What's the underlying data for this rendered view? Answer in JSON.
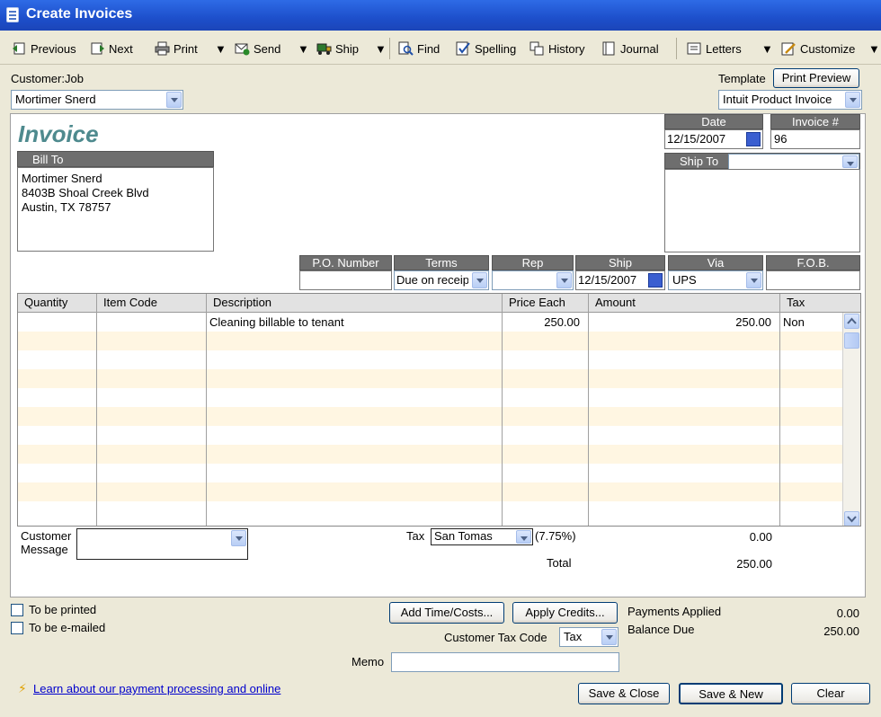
{
  "window": {
    "title": "Create Invoices"
  },
  "toolbar": {
    "previous": "Previous",
    "next": "Next",
    "print": "Print",
    "send": "Send",
    "ship": "Ship",
    "find": "Find",
    "spelling": "Spelling",
    "history": "History",
    "journal": "Journal",
    "letters": "Letters",
    "customize": "Customize"
  },
  "header": {
    "customer_job_label": "Customer:Job",
    "customer_value": "Mortimer Snerd",
    "template_label": "Template",
    "print_preview": "Print Preview",
    "template_value": "Intuit Product Invoice"
  },
  "form": {
    "title": "Invoice",
    "date_label": "Date",
    "date_value": "12/15/2007",
    "invoice_no_label": "Invoice #",
    "invoice_no_value": "96",
    "bill_to_label": "Bill To",
    "bill_to_lines": [
      "Mortimer Snerd",
      "8403B Shoal Creek Blvd",
      "Austin, TX 78757"
    ],
    "ship_to_label": "Ship To",
    "ship_to_value": "",
    "po_label": "P.O. Number",
    "po_value": "",
    "terms_label": "Terms",
    "terms_value": "Due on receipt",
    "rep_label": "Rep",
    "rep_value": "",
    "ship_label": "Ship",
    "ship_value": "12/15/2007",
    "via_label": "Via",
    "via_value": "UPS",
    "fob_label": "F.O.B.",
    "fob_value": ""
  },
  "grid": {
    "columns": [
      "Quantity",
      "Item Code",
      "Description",
      "Price Each",
      "Amount",
      "Tax"
    ],
    "rows": [
      {
        "quantity": "",
        "item_code": "",
        "description": "Cleaning billable to tenant",
        "price_each": "250.00",
        "amount": "250.00",
        "tax": "Non"
      }
    ]
  },
  "totals": {
    "customer_message_label_1": "Customer",
    "customer_message_label_2": "Message",
    "customer_message_value": "",
    "tax_label": "Tax",
    "tax_item": "San Tomas",
    "tax_rate": "(7.75%)",
    "tax_amount": "0.00",
    "total_label": "Total",
    "total_value": "250.00"
  },
  "footer": {
    "to_be_printed": "To be printed",
    "to_be_emailed": "To be e-mailed",
    "add_time_costs": "Add Time/Costs...",
    "apply_credits": "Apply Credits...",
    "payments_applied_label": "Payments Applied",
    "payments_applied_value": "0.00",
    "balance_due_label": "Balance Due",
    "balance_due_value": "250.00",
    "customer_tax_code_label": "Customer Tax Code",
    "customer_tax_code_value": "Tax",
    "memo_label": "Memo",
    "memo_value": "",
    "learn_link": "Learn about our payment processing and online",
    "save_close": "Save & Close",
    "save_new": "Save & New",
    "clear": "Clear"
  },
  "colors": {
    "titlebar": "#1D4FCB",
    "invoice_title": "#4E8A8E",
    "header_fill": "#6E6E6E",
    "row_stripe": "#FFF6E2"
  }
}
